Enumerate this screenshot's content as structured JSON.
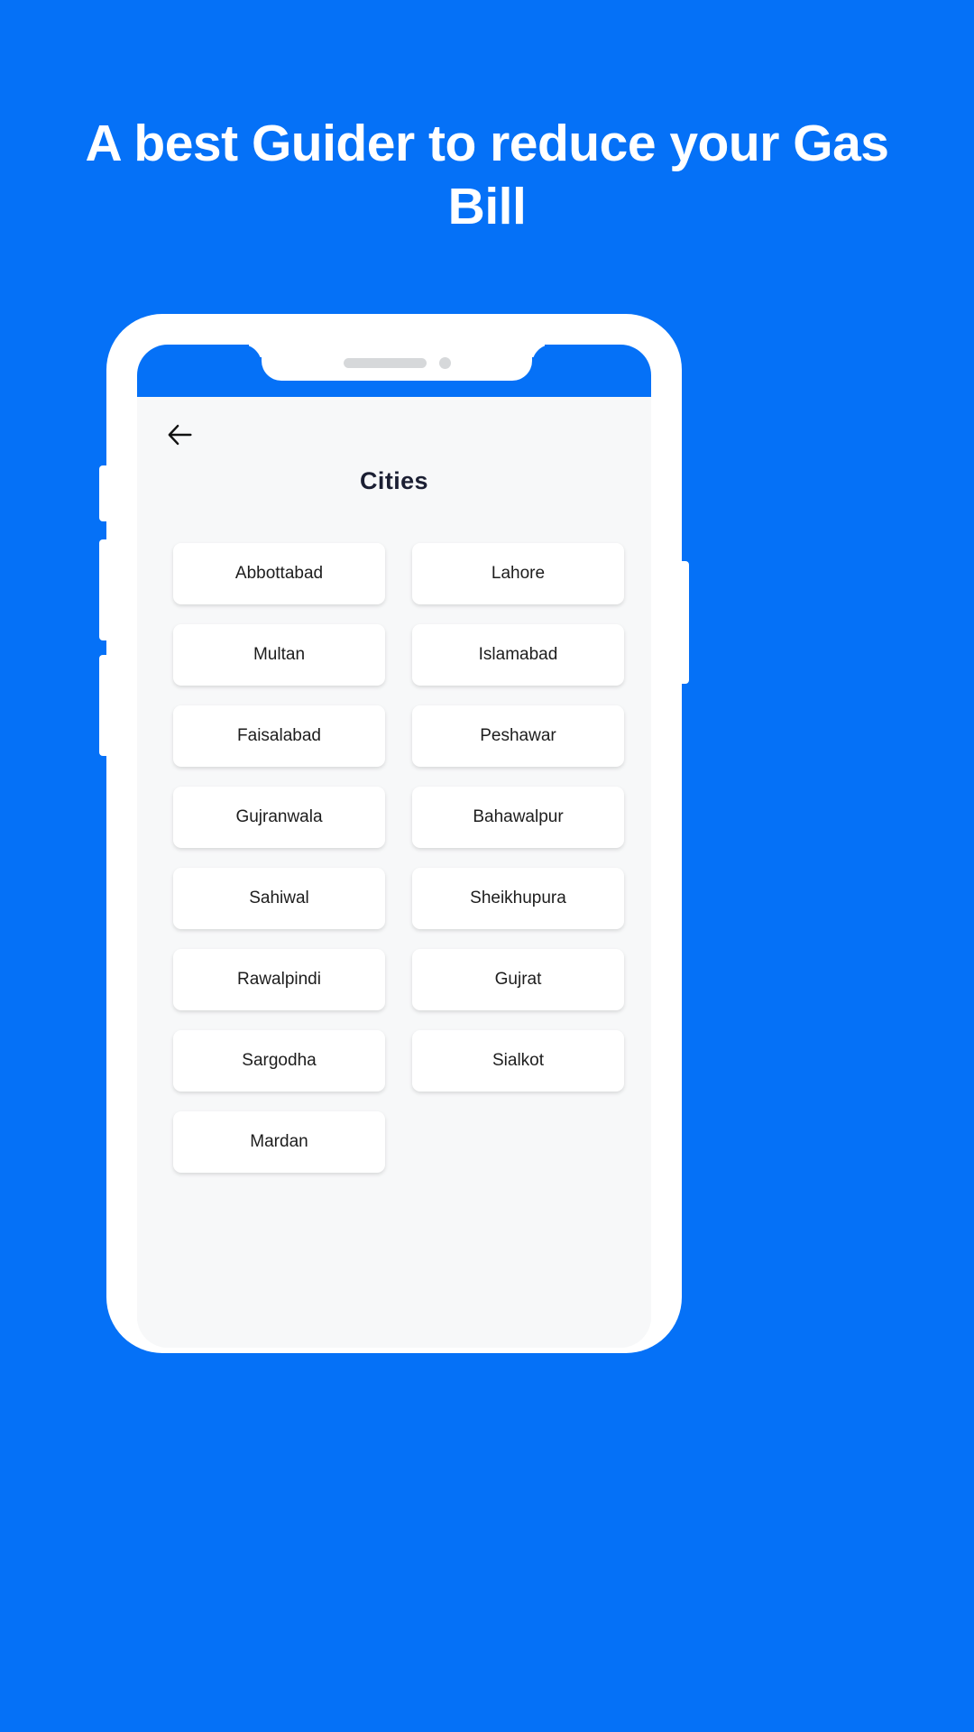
{
  "promo": {
    "headline_line1": "A best Guider to reduce your",
    "headline_line2": "Gas Bill",
    "background_color": "#0571f7",
    "text_color": "#ffffff"
  },
  "phone": {
    "notch": {
      "speaker_icon": "speaker-grille-icon",
      "camera_icon": "front-camera-icon"
    },
    "side_buttons": [
      "volume-up",
      "volume-down",
      "silent-switch",
      "power"
    ]
  },
  "app": {
    "back_icon": "back-arrow-icon",
    "title": "Cities",
    "status_bar_color": "#0571f7",
    "screen_background": "#f7f8f9",
    "card_background": "#ffffff",
    "card_text_color": "#1d1d1d",
    "cities": [
      "Abbottabad",
      "Lahore",
      "Multan",
      "Islamabad",
      "Faisalabad",
      "Peshawar",
      "Gujranwala",
      "Bahawalpur",
      "Sahiwal",
      "Sheikhupura",
      "Rawalpindi",
      "Gujrat",
      "Sargodha",
      "Sialkot",
      "Mardan"
    ]
  }
}
